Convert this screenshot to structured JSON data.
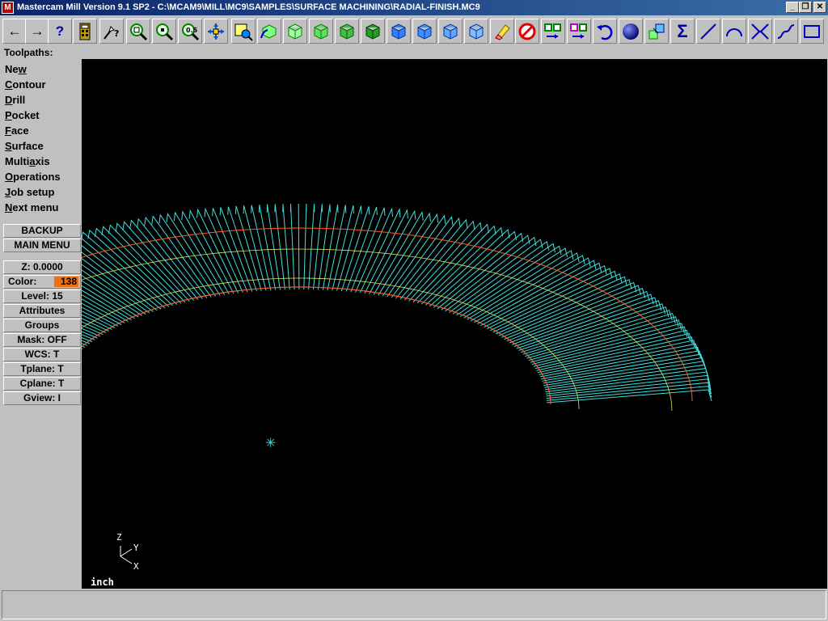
{
  "window": {
    "title": "Mastercam Mill Version 9.1 SP2 - C:\\MCAM9\\MILL\\MC9\\SAMPLES\\SURFACE MACHINING\\RADIAL-FINISH.MC9",
    "app_icon_label": "M",
    "min_label": "_",
    "max_label": "❐",
    "close_label": "✕"
  },
  "toolbar": {
    "buttons": [
      "back-arrow",
      "forward-arrow",
      "help",
      "calculator",
      "analyze",
      "zoom-window",
      "zoom-in",
      "zoom-out",
      "pan",
      "screen-fit",
      "rotate",
      "cube-iso",
      "cube-top",
      "cube-front",
      "cube-side",
      "cube-dynamic",
      "cube-blue-1",
      "cube-blue-2",
      "cube-blue-3",
      "eraser",
      "no-entry",
      "transform-1",
      "transform-2",
      "undo",
      "sphere",
      "layers",
      "sigma",
      "line",
      "arc",
      "fillet",
      "spline",
      "rectangle"
    ]
  },
  "toolpaths_label": "Toolpaths:",
  "menu": {
    "items": [
      {
        "pre": "Ne",
        "ul": "w",
        "post": ""
      },
      {
        "pre": "",
        "ul": "C",
        "post": "ontour"
      },
      {
        "pre": "",
        "ul": "D",
        "post": "rill"
      },
      {
        "pre": "",
        "ul": "P",
        "post": "ocket"
      },
      {
        "pre": "",
        "ul": "F",
        "post": "ace"
      },
      {
        "pre": "",
        "ul": "S",
        "post": "urface"
      },
      {
        "pre": "Multi",
        "ul": "a",
        "post": "xis"
      },
      {
        "pre": "",
        "ul": "O",
        "post": "perations"
      },
      {
        "pre": "",
        "ul": "J",
        "post": "ob setup"
      },
      {
        "pre": "",
        "ul": "N",
        "post": "ext menu"
      }
    ]
  },
  "panel": {
    "backup": "BACKUP",
    "main_menu": "MAIN MENU",
    "z": "Z:  0.0000",
    "color_label": "Color:",
    "color_value": "138",
    "level": "Level: 15",
    "attributes": "Attributes",
    "groups": "Groups",
    "mask": "Mask:  OFF",
    "wcs": "WCS:   T",
    "tplane": "Tplane:  T",
    "cplane": "Cplane:  T",
    "gview": "Gview:   I"
  },
  "viewport": {
    "units": "inch",
    "axis_z": "Z",
    "axis_y": "Y",
    "axis_x": "X",
    "toolpath_color": "#40e0e0",
    "boundary_color": "#ff5a28",
    "surface_color": "#e0e060"
  },
  "status": {}
}
